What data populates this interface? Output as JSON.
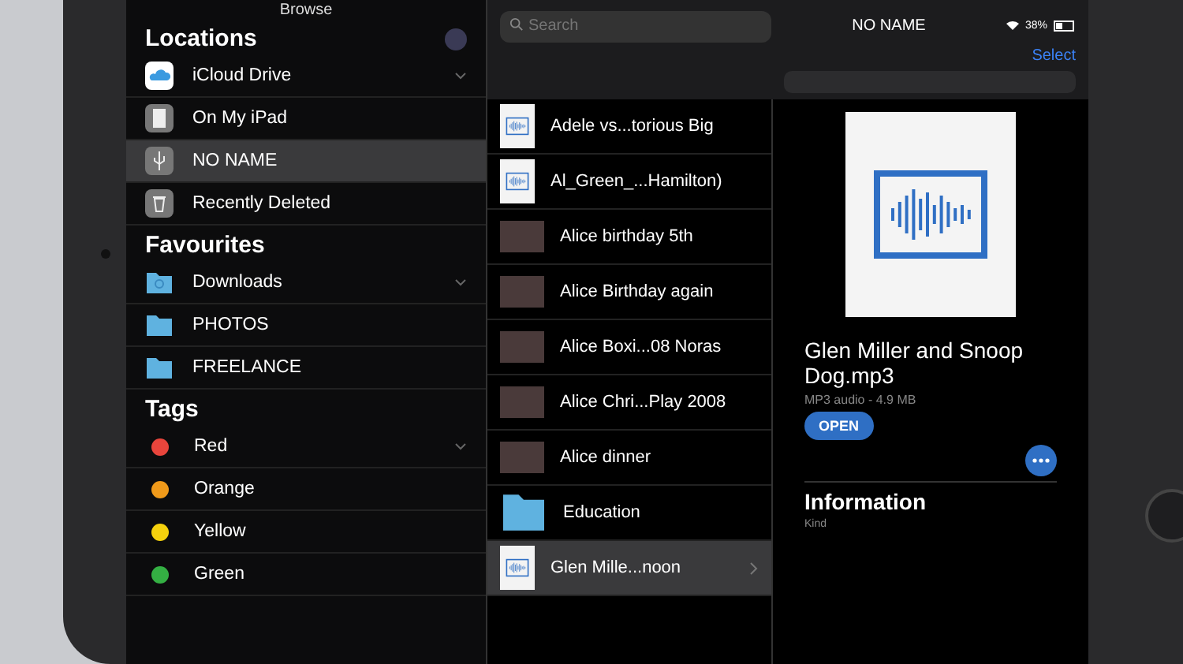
{
  "status_bar": {
    "battery": "38%"
  },
  "sidebar": {
    "title": "Browse",
    "sections": [
      {
        "title": "Locations",
        "items": [
          {
            "label": "iCloud Drive",
            "kind": "cloud",
            "selected": false
          },
          {
            "label": "On My iPad",
            "kind": "tablet",
            "selected": false
          },
          {
            "label": "NO NAME",
            "kind": "usb",
            "selected": true
          },
          {
            "label": "Recently Deleted",
            "kind": "trash",
            "selected": false
          }
        ]
      },
      {
        "title": "Favourites",
        "items": [
          {
            "label": "Downloads",
            "kind": "download-folder"
          },
          {
            "label": "PHOTOS",
            "kind": "folder"
          },
          {
            "label": "FREELANCE",
            "kind": "folder"
          }
        ]
      },
      {
        "title": "Tags",
        "items": [
          {
            "label": "Red",
            "kind": "tag",
            "color": "#e8453c"
          },
          {
            "label": "Orange",
            "kind": "tag",
            "color": "#f09a1a"
          },
          {
            "label": "Yellow",
            "kind": "tag",
            "color": "#f5d10d"
          },
          {
            "label": "Green",
            "kind": "tag",
            "color": "#34b043"
          }
        ]
      }
    ]
  },
  "search": {
    "placeholder": "Search"
  },
  "header": {
    "title": "NO NAME",
    "action": "Select"
  },
  "files": [
    {
      "name": "Adele vs...torious Big",
      "kind": "audio",
      "selected": false
    },
    {
      "name": "Al_Green_...Hamilton)",
      "kind": "audio",
      "selected": false
    },
    {
      "name": "Alice birthday 5th",
      "kind": "video",
      "selected": false
    },
    {
      "name": "Alice Birthday again",
      "kind": "video",
      "selected": false
    },
    {
      "name": "Alice Boxi...08 Noras",
      "kind": "video",
      "selected": false
    },
    {
      "name": "Alice Chri...Play 2008",
      "kind": "video",
      "selected": false
    },
    {
      "name": "Alice dinner",
      "kind": "video",
      "selected": false
    },
    {
      "name": "Education",
      "kind": "folder",
      "selected": false
    },
    {
      "name": "Glen Mille...noon",
      "kind": "audio",
      "selected": true
    }
  ],
  "detail": {
    "name": "Glen Miller and Snoop Dog.mp3",
    "meta": "MP3 audio - 4.9 MB",
    "open": "OPEN",
    "info_title": "Information",
    "info_rows": [
      {
        "label": "Kind"
      }
    ]
  }
}
